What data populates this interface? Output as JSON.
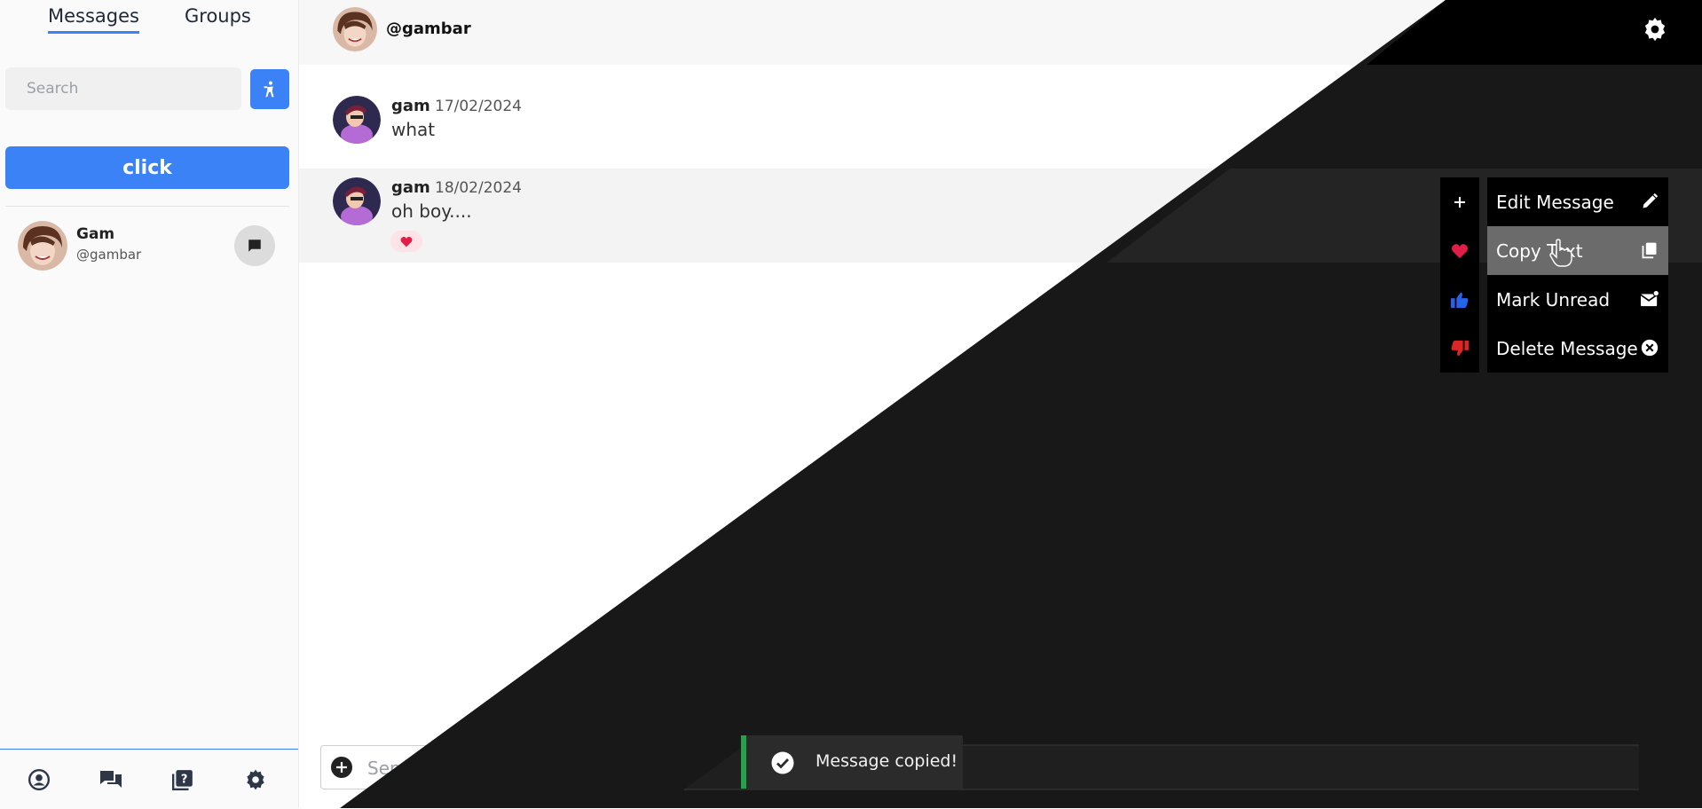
{
  "sidebar": {
    "tabs": [
      {
        "label": "Messages",
        "active": true
      },
      {
        "label": "Groups",
        "active": false
      }
    ],
    "search": {
      "placeholder": "Search",
      "value": ""
    },
    "action_icon": "accessibility-icon",
    "click_button": "click",
    "contacts": [
      {
        "name": "Gam",
        "handle": "@gambar",
        "action_icon": "chat-bubble-icon"
      }
    ],
    "bottom_nav": [
      "profile-icon",
      "conversations-icon",
      "help-book-icon",
      "settings-gear-icon"
    ]
  },
  "chat": {
    "header_handle": "@gambar",
    "messages": [
      {
        "author": "gam",
        "date": "17/02/2024",
        "text": "what",
        "reactions": []
      },
      {
        "author": "gam",
        "date": "18/02/2024",
        "text": "oh boy....",
        "reactions": [
          "heart"
        ]
      }
    ],
    "composer": {
      "placeholder": "Send a message",
      "value": ""
    }
  },
  "context_menu": {
    "reactions": [
      "plus",
      "heart",
      "thumbs-up",
      "thumbs-down"
    ],
    "items": [
      {
        "label": "Edit Message",
        "icon": "pencil-icon"
      },
      {
        "label": "Copy Text",
        "icon": "copy-icon",
        "hover": true
      },
      {
        "label": "Mark Unread",
        "icon": "mark-unread-icon"
      },
      {
        "label": "Delete Message",
        "icon": "delete-circle-icon"
      }
    ]
  },
  "toast": {
    "text": "Message copied!",
    "icon": "check-circle-icon"
  },
  "colors": {
    "accent": "#3b82f6",
    "dark_bg": "#181818",
    "toast_bg": "#2b2b2b",
    "toast_accent": "#22a34a",
    "heart": "#e11d48",
    "thumbs_up": "#2563eb",
    "thumbs_down": "#dc2626"
  }
}
